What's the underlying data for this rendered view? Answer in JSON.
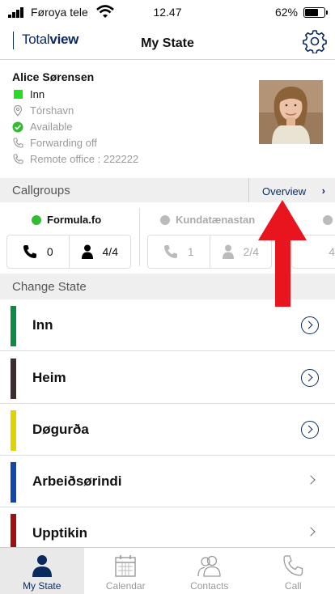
{
  "status_bar": {
    "carrier": "Føroya tele",
    "time": "12.47",
    "battery": "62%",
    "battery_level": 0.62
  },
  "header": {
    "logo_light": "Total",
    "logo_bold": "view",
    "title": "My State"
  },
  "profile": {
    "name": "Alice Sørensen",
    "state": "Inn",
    "state_color": "#22dd22",
    "location": "Tórshavn",
    "availability": "Available",
    "forwarding": "Forwarding off",
    "remote_office": "Remote office : 222222"
  },
  "callgroups": {
    "title": "Callgroups",
    "overview_label": "Overview",
    "groups": [
      {
        "name": "Formula.fo",
        "status_color": "#33bb33",
        "calls": "0",
        "agents": "4/4"
      },
      {
        "name": "Kundatænastan",
        "status_color": "#bbbbbb",
        "calls": "1",
        "agents": "2/4"
      },
      {
        "name": "",
        "status_color": "#bbbbbb",
        "calls": "",
        "agents": "4"
      }
    ]
  },
  "change_state": {
    "title": "Change State",
    "items": [
      {
        "label": "Inn",
        "color": "#0e8a44",
        "action": "circle"
      },
      {
        "label": "Heim",
        "color": "#3b2d2d",
        "action": "circle"
      },
      {
        "label": "Døgurða",
        "color": "#e0d400",
        "action": "circle"
      },
      {
        "label": "Arbeiðsørindi",
        "color": "#1148a8",
        "action": "chevron"
      },
      {
        "label": "Upptikin",
        "color": "#a01010",
        "action": "chevron"
      }
    ]
  },
  "tabs": [
    {
      "label": "My State",
      "icon": "person-icon",
      "active": true
    },
    {
      "label": "Calendar",
      "icon": "calendar-icon",
      "active": false
    },
    {
      "label": "Contacts",
      "icon": "contacts-icon",
      "active": false
    },
    {
      "label": "Call",
      "icon": "phone-icon",
      "active": false
    }
  ],
  "accent_color": "#0a2a5e",
  "annotation_color": "#e8141e"
}
